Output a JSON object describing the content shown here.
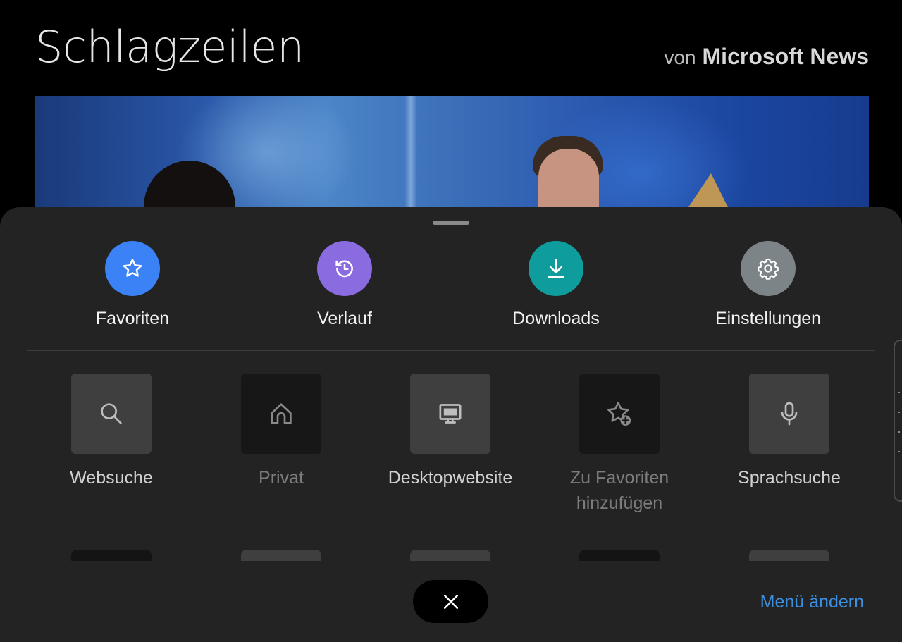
{
  "page": {
    "title": "Schlagzeilen",
    "source_prefix": "von",
    "source_name": "Microsoft News"
  },
  "menu": {
    "quick_actions": [
      {
        "label": "Favoriten",
        "icon": "star-icon",
        "color": "#3b82f6"
      },
      {
        "label": "Verlauf",
        "icon": "history-icon",
        "color": "#8b6be0"
      },
      {
        "label": "Downloads",
        "icon": "download-icon",
        "color": "#0f9c9c"
      },
      {
        "label": "Einstellungen",
        "icon": "gear-icon",
        "color": "#7d8488"
      }
    ],
    "items": [
      {
        "label": "Websuche",
        "icon": "search-icon",
        "enabled": true
      },
      {
        "label": "Privat",
        "icon": "home-icon",
        "enabled": false
      },
      {
        "label": "Desktopwebsite",
        "icon": "desktop-icon",
        "enabled": true
      },
      {
        "label": "Zu Favoriten hinzufügen",
        "icon": "star-add-icon",
        "enabled": false
      },
      {
        "label": "Sprachsuche",
        "icon": "microphone-icon",
        "enabled": true
      }
    ],
    "edit_link": "Menü ändern",
    "accent_color": "#3d8fe0"
  }
}
